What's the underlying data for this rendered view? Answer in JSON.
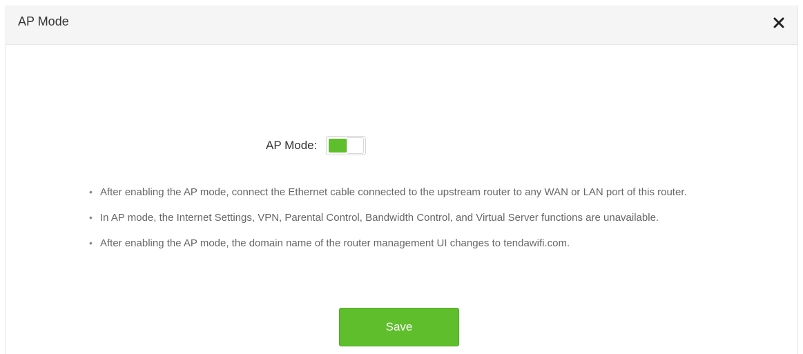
{
  "dialog": {
    "title": "AP Mode",
    "close_icon": "close-icon"
  },
  "ap_mode": {
    "label": "AP Mode:",
    "enabled": true
  },
  "notes": [
    "After enabling the AP mode, connect the Ethernet cable connected to the upstream router to any WAN or LAN port of this router.",
    "In AP mode, the Internet Settings, VPN, Parental Control, Bandwidth Control, and Virtual Server functions are unavailable.",
    "After enabling the AP mode, the domain name of the router management UI changes to tendawifi.com."
  ],
  "bullet": "•",
  "save_button": {
    "label": "Save"
  },
  "colors": {
    "accent": "#5ebe2c",
    "header_bg": "#f5f5f5",
    "note_text": "#666666"
  }
}
